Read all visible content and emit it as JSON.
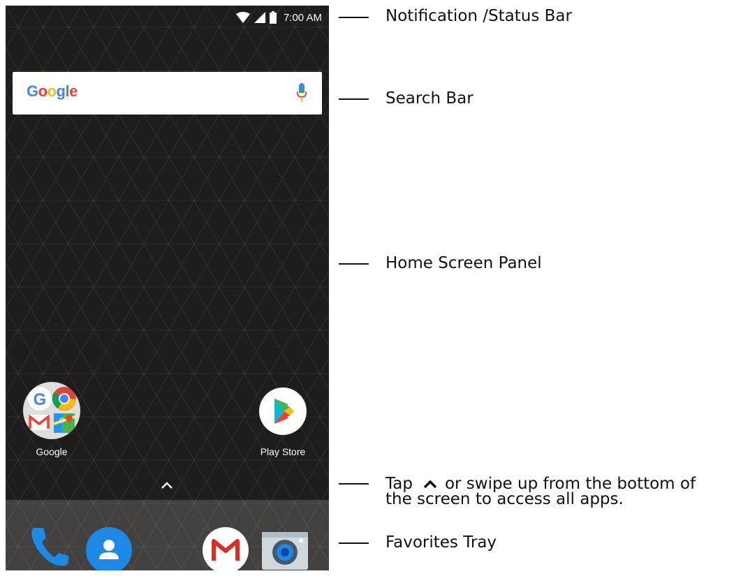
{
  "status_bar": {
    "time": "7:00 AM"
  },
  "search_bar": {
    "logo_text": "Google"
  },
  "home_apps": [
    {
      "label": "Google",
      "icon": "google-folder-icon"
    },
    {
      "label": "Play Store",
      "icon": "play-store-icon"
    }
  ],
  "favorites_tray": [
    {
      "icon": "phone-icon"
    },
    {
      "icon": "contacts-icon"
    },
    {
      "icon": "gmail-icon"
    },
    {
      "icon": "camera-icon"
    }
  ],
  "callouts": {
    "status_bar": "Notification /Status Bar",
    "search_bar": "Search Bar",
    "home_panel": "Home Screen Panel",
    "tap_prefix": "Tap",
    "tap_suffix": "or swipe up from the bottom of",
    "tap_line2": "the screen to access all apps.",
    "favorites": "Favorites Tray"
  },
  "colors": {
    "google_blue": "#4285F4",
    "google_red": "#EA4335",
    "google_yellow": "#FBBC05",
    "google_green": "#34A853",
    "phone_blue": "#1E88E5"
  }
}
